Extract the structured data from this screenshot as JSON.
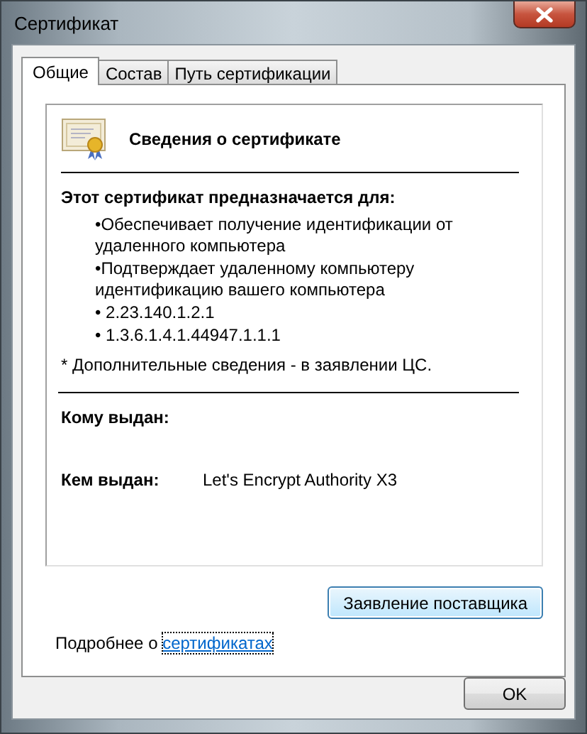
{
  "window": {
    "title": "Сертификат"
  },
  "tabs": [
    {
      "label": "Общие",
      "selected": true
    },
    {
      "label": "Состав",
      "selected": false
    },
    {
      "label": "Путь сертификации",
      "selected": false
    }
  ],
  "info": {
    "heading": "Сведения о сертификате",
    "purpose_title": "Этот сертификат предназначается для:",
    "purposes": [
      "•Обеспечивает получение идентификации от удаленного компьютера",
      "•Подтверждает удаленному компьютеру идентификацию вашего компьютера",
      "• 2.23.140.1.2.1",
      "• 1.3.6.1.4.1.44947.1.1.1"
    ],
    "note": "* Дополнительные сведения - в заявлении ЦС.",
    "issued_to_label": "Кому выдан:",
    "issued_by_label": "Кем выдан:",
    "issued_by_value": "Let's Encrypt Authority X3"
  },
  "issuer_statement_button": "Заявление поставщика",
  "learn_more": {
    "text": "Подробнее о",
    "link": "сертификатах"
  },
  "ok_button": "OK"
}
